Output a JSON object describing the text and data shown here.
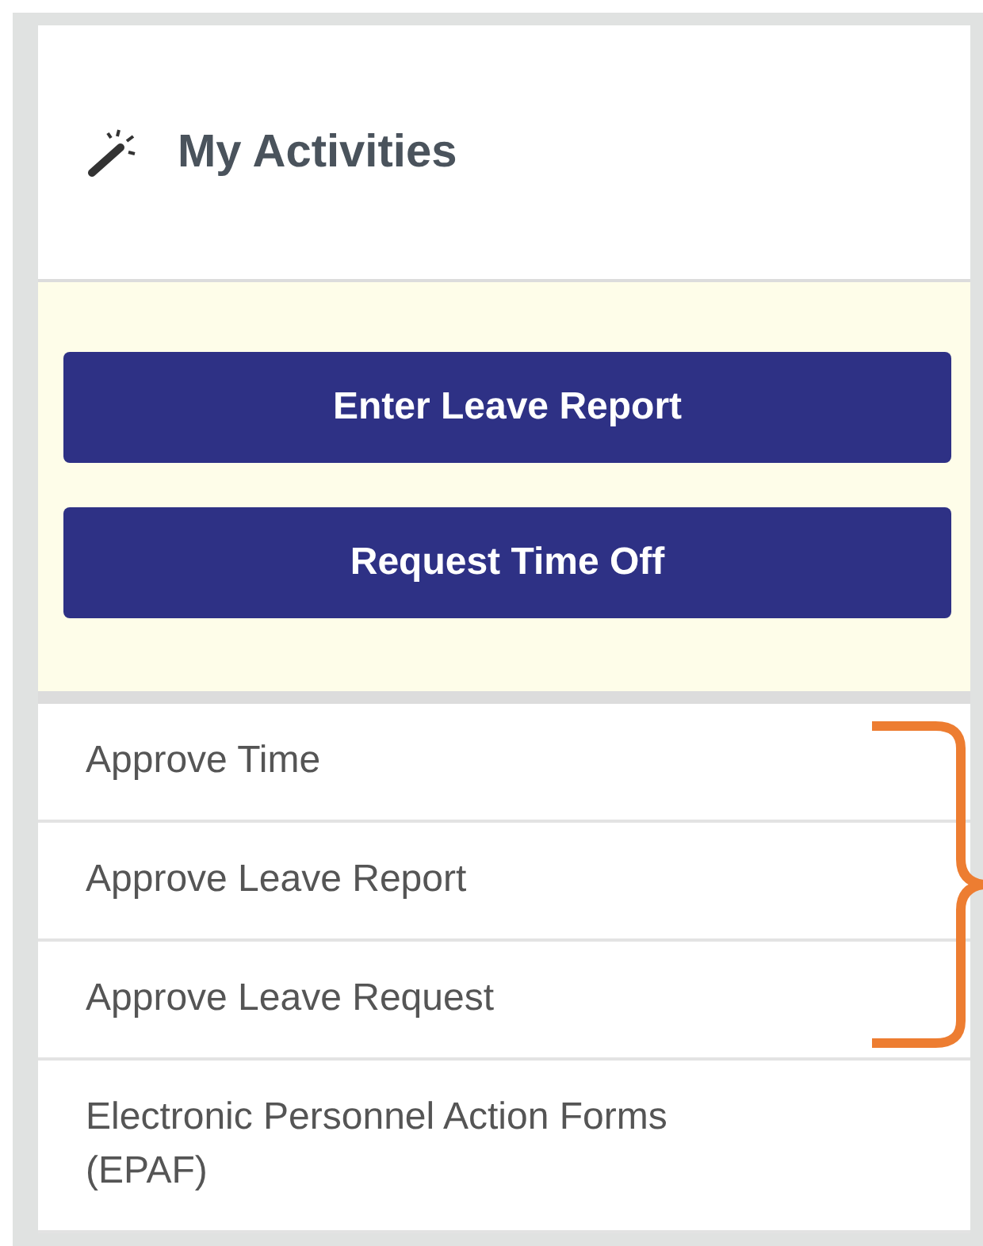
{
  "header": {
    "title": "My Activities"
  },
  "buttons": [
    "Enter Leave Report",
    "Request Time Off"
  ],
  "items": [
    {
      "label": "Approve Time"
    },
    {
      "label": "Approve Leave Report"
    },
    {
      "label": "Approve Leave Request"
    },
    {
      "label": "Electronic Personnel Action Forms (EPAF)"
    }
  ]
}
